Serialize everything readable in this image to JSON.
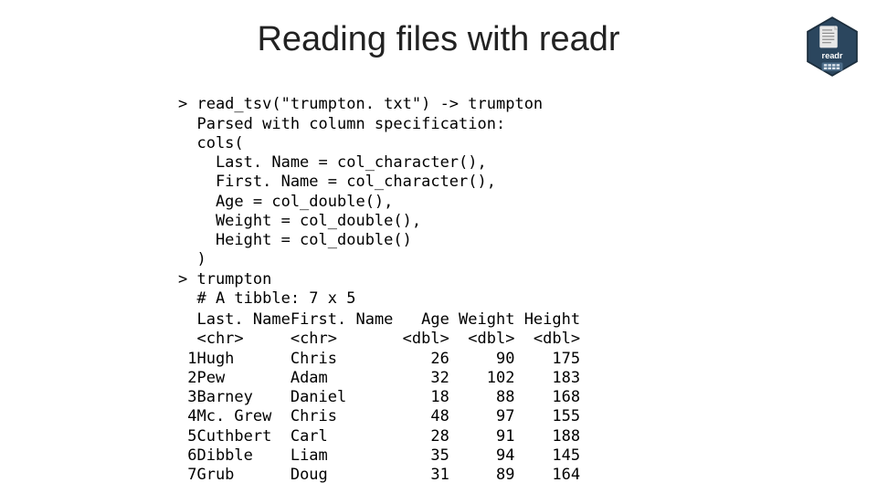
{
  "title": "Reading files with readr",
  "badge": {
    "label": "readr"
  },
  "console": {
    "line1": "> read_tsv(\"trumpton. txt\") -> trumpton",
    "spec1": "Parsed with column specification:",
    "spec2": "cols(",
    "spec3": "  Last. Name = col_character(),",
    "spec4": "  First. Name = col_character(),",
    "spec5": "  Age = col_double(),",
    "spec6": "  Weight = col_double(),",
    "spec7": "  Height = col_double()",
    "spec8": ")",
    "line2": "> trumpton",
    "tibble": "# A tibble: 7 x 5"
  },
  "table": {
    "headers": {
      "idx": "",
      "last": "Last. Name",
      "first": "First. Name",
      "age": "Age",
      "weight": "Weight",
      "height": "Height"
    },
    "types": {
      "idx": "",
      "last": "<chr>",
      "first": "<chr>",
      "age": "<dbl>",
      "weight": "<dbl>",
      "height": "<dbl>"
    },
    "rows": [
      {
        "idx": "1",
        "last": "Hugh",
        "first": "Chris",
        "age": "26",
        "weight": "90",
        "height": "175"
      },
      {
        "idx": "2",
        "last": "Pew",
        "first": "Adam",
        "age": "32",
        "weight": "102",
        "height": "183"
      },
      {
        "idx": "3",
        "last": "Barney",
        "first": "Daniel",
        "age": "18",
        "weight": "88",
        "height": "168"
      },
      {
        "idx": "4",
        "last": "Mc. Grew",
        "first": "Chris",
        "age": "48",
        "weight": "97",
        "height": "155"
      },
      {
        "idx": "5",
        "last": "Cuthbert",
        "first": "Carl",
        "age": "28",
        "weight": "91",
        "height": "188"
      },
      {
        "idx": "6",
        "last": "Dibble",
        "first": "Liam",
        "age": "35",
        "weight": "94",
        "height": "145"
      },
      {
        "idx": "7",
        "last": "Grub",
        "first": "Doug",
        "age": "31",
        "weight": "89",
        "height": "164"
      }
    ]
  }
}
